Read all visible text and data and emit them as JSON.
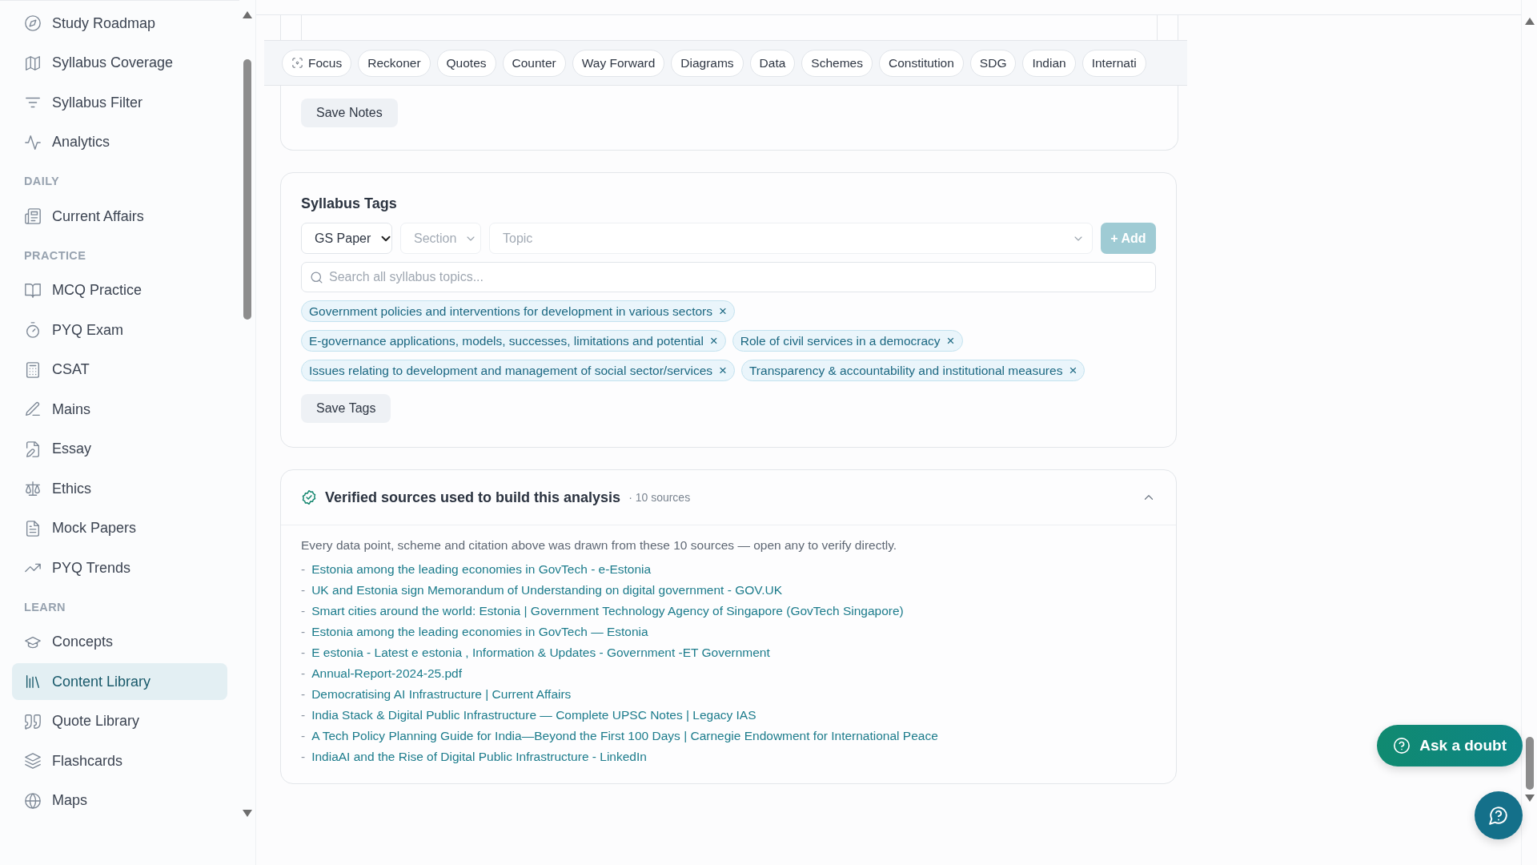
{
  "sidebar": {
    "sections": [
      {
        "items": [
          {
            "label": "Study Roadmap",
            "selected": false
          },
          {
            "label": "Syllabus Coverage",
            "selected": false
          },
          {
            "label": "Syllabus Filter",
            "selected": false
          },
          {
            "label": "Analytics",
            "selected": false
          }
        ]
      },
      {
        "heading": "DAILY",
        "items": [
          {
            "label": "Current Affairs",
            "selected": false
          }
        ]
      },
      {
        "heading": "PRACTICE",
        "items": [
          {
            "label": "MCQ Practice",
            "selected": false
          },
          {
            "label": "PYQ Exam",
            "selected": false
          },
          {
            "label": "CSAT",
            "selected": false
          },
          {
            "label": "Mains",
            "selected": false
          },
          {
            "label": "Essay",
            "selected": false
          },
          {
            "label": "Ethics",
            "selected": false
          },
          {
            "label": "Mock Papers",
            "selected": false
          },
          {
            "label": "PYQ Trends",
            "selected": false
          }
        ]
      },
      {
        "heading": "LEARN",
        "items": [
          {
            "label": "Concepts",
            "selected": false
          },
          {
            "label": "Content Library",
            "selected": true
          },
          {
            "label": "Quote Library",
            "selected": false
          },
          {
            "label": "Flashcards",
            "selected": false
          },
          {
            "label": "Maps",
            "selected": false
          }
        ]
      }
    ]
  },
  "notes": {
    "toolbar": [
      {
        "label": "Focus",
        "kind": "focus"
      },
      {
        "label": "Reckoner",
        "kind": "chip"
      },
      {
        "label": "Quotes",
        "kind": "chip"
      },
      {
        "label": "Counter",
        "kind": "chip"
      },
      {
        "label": "Way Forward",
        "kind": "chip"
      },
      {
        "label": "Diagrams",
        "kind": "chip"
      },
      {
        "label": "Data",
        "kind": "chip"
      },
      {
        "label": "Schemes",
        "kind": "chip"
      },
      {
        "label": "Constitution",
        "kind": "chip"
      },
      {
        "label": "SDG",
        "kind": "chip"
      },
      {
        "label": "Indian",
        "kind": "chip"
      },
      {
        "label": "Internati",
        "kind": "chip"
      }
    ],
    "save_button": "Save Notes"
  },
  "syllabus_tags": {
    "title": "Syllabus Tags",
    "paper_select": {
      "value": "GS Paper",
      "disabled": false
    },
    "section_select": {
      "placeholder": "Section",
      "disabled": true
    },
    "topic_select": {
      "placeholder": "Topic",
      "disabled": true
    },
    "add_button": {
      "label": "+ Add",
      "disabled": true
    },
    "search": {
      "placeholder": "Search all syllabus topics..."
    },
    "tags": [
      {
        "label": "Government policies and interventions for development in various sectors",
        "remove": "×"
      },
      {
        "label": "E-governance applications, models, successes, limitations and potential",
        "remove": "×"
      },
      {
        "label": "Role of civil services in a democracy",
        "remove": "×"
      },
      {
        "label": "Issues relating to development and management of social sector/services",
        "remove": "×"
      },
      {
        "label": "Transparency & accountability and institutional measures",
        "remove": "×"
      }
    ],
    "save_button": "Save Tags"
  },
  "sources": {
    "title": "Verified sources used to build this analysis",
    "count": "· 10 sources",
    "expanded": true,
    "description": "Every data point, scheme and citation above was drawn from these 10 sources — open any to verify directly.",
    "links": [
      {
        "bullet": "-",
        "title": "Estonia among the leading economies in GovTech - e-Estonia"
      },
      {
        "bullet": "-",
        "title": "UK and Estonia sign Memorandum of Understanding on digital government - GOV.UK"
      },
      {
        "bullet": "-",
        "title": "Smart cities around the world: Estonia | Government Technology Agency of Singapore (GovTech Singapore)"
      },
      {
        "bullet": "-",
        "title": "Estonia among the leading economies in GovTech — Estonia"
      },
      {
        "bullet": "-",
        "title": "E estonia - Latest e estonia , Information & Updates - Government -ET Government"
      },
      {
        "bullet": "-",
        "title": "Annual-Report-2024-25.pdf"
      },
      {
        "bullet": "-",
        "title": "Democratising AI Infrastructure | Current Affairs"
      },
      {
        "bullet": "-",
        "title": "India Stack & Digital Public Infrastructure — Complete UPSC Notes | Legacy IAS"
      },
      {
        "bullet": "-",
        "title": "A Tech Policy Planning Guide for India—Beyond the First 100 Days | Carnegie Endowment for International Peace"
      },
      {
        "bullet": "-",
        "title": "IndiaAI and the Rise of Digital Public Infrastructure - LinkedIn"
      }
    ]
  },
  "ask_button": {
    "label": "Ask a doubt"
  }
}
